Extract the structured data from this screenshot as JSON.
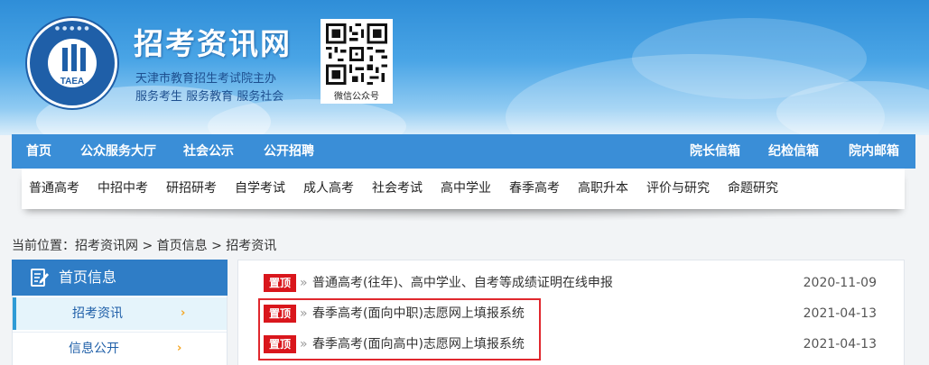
{
  "header": {
    "site_title": "招考资讯网",
    "subtitle_1": "天津市教育招生考试院主办",
    "subtitle_2": "服务考生 服务教育 服务社会",
    "logo_abbr": "TAEA",
    "qr_caption": "微信公众号"
  },
  "main_nav": {
    "left": [
      "首页",
      "公众服务大厅",
      "社会公示",
      "公开招聘"
    ],
    "right": [
      "院长信箱",
      "纪检信箱",
      "院内邮箱"
    ]
  },
  "sub_nav": [
    "普通高考",
    "中招中考",
    "研招研考",
    "自学考试",
    "成人高考",
    "社会考试",
    "高中学业",
    "春季高考",
    "高职升本",
    "评价与研究",
    "命题研究"
  ],
  "breadcrumb": "当前位置：招考资讯网 > 首页信息 > 招考资讯",
  "sidebar": {
    "title": "首页信息",
    "items": [
      {
        "label": "招考资讯",
        "arrow": "›",
        "active": true
      },
      {
        "label": "信息公开",
        "arrow": "›",
        "active": false
      }
    ]
  },
  "news": [
    {
      "badge": "置顶",
      "chevron": "»",
      "title": "普通高考(往年)、高中学业、自考等成绩证明在线申报",
      "date": "2020-11-09"
    },
    {
      "badge": "置顶",
      "chevron": "»",
      "title": "春季高考(面向中职)志愿网上填报系统",
      "date": "2021-04-13"
    },
    {
      "badge": "置顶",
      "chevron": "»",
      "title": "春季高考(面向高中)志愿网上填报系统",
      "date": "2021-04-13"
    }
  ],
  "colors": {
    "nav_bg": "#3a8ed7",
    "sidebar_head_bg": "#2f7dc6",
    "badge_red": "#d9161c",
    "highlight_red": "#e0282e",
    "arrow_orange": "#f5a623"
  }
}
